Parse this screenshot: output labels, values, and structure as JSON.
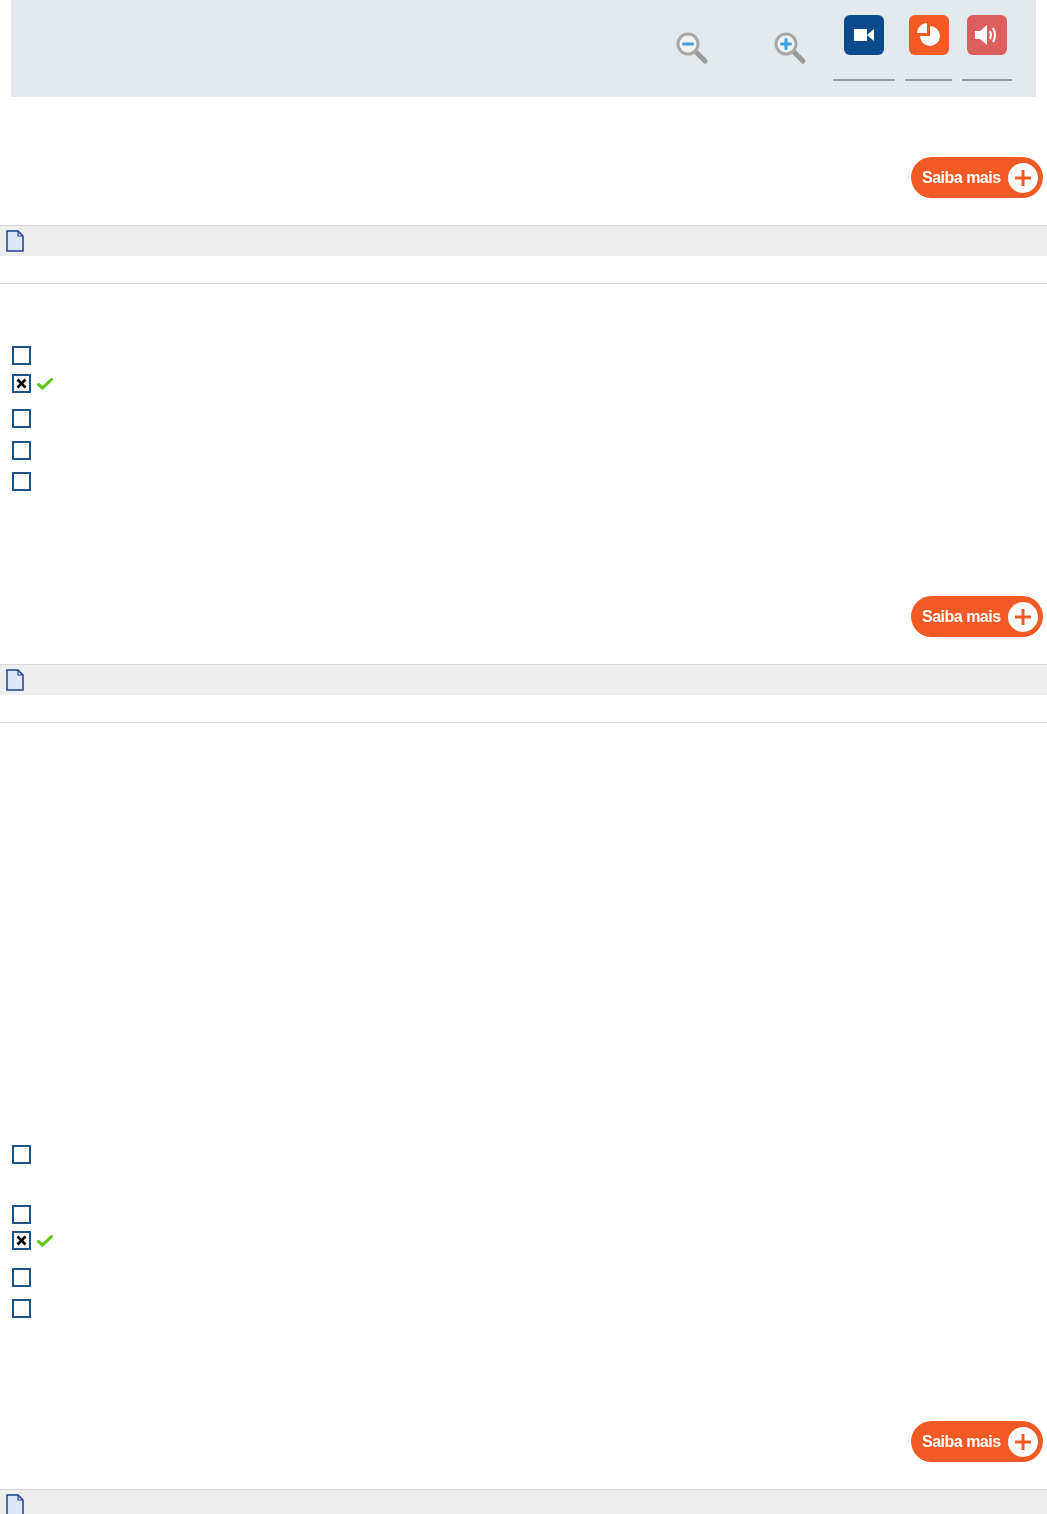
{
  "sections": [
    {
      "more_button": "Saiba mais"
    },
    {
      "options": [
        {
          "checked": false,
          "correct": false
        },
        {
          "checked": true,
          "correct": true
        },
        {
          "checked": false,
          "correct": false
        },
        {
          "checked": false,
          "correct": false
        },
        {
          "checked": false,
          "correct": false
        }
      ],
      "more_button": "Saiba mais"
    },
    {
      "options": [
        {
          "checked": false,
          "correct": false
        },
        {
          "checked": false,
          "correct": false
        },
        {
          "checked": true,
          "correct": true
        },
        {
          "checked": false,
          "correct": false
        },
        {
          "checked": false,
          "correct": false
        }
      ],
      "more_button": "Saiba mais"
    }
  ]
}
